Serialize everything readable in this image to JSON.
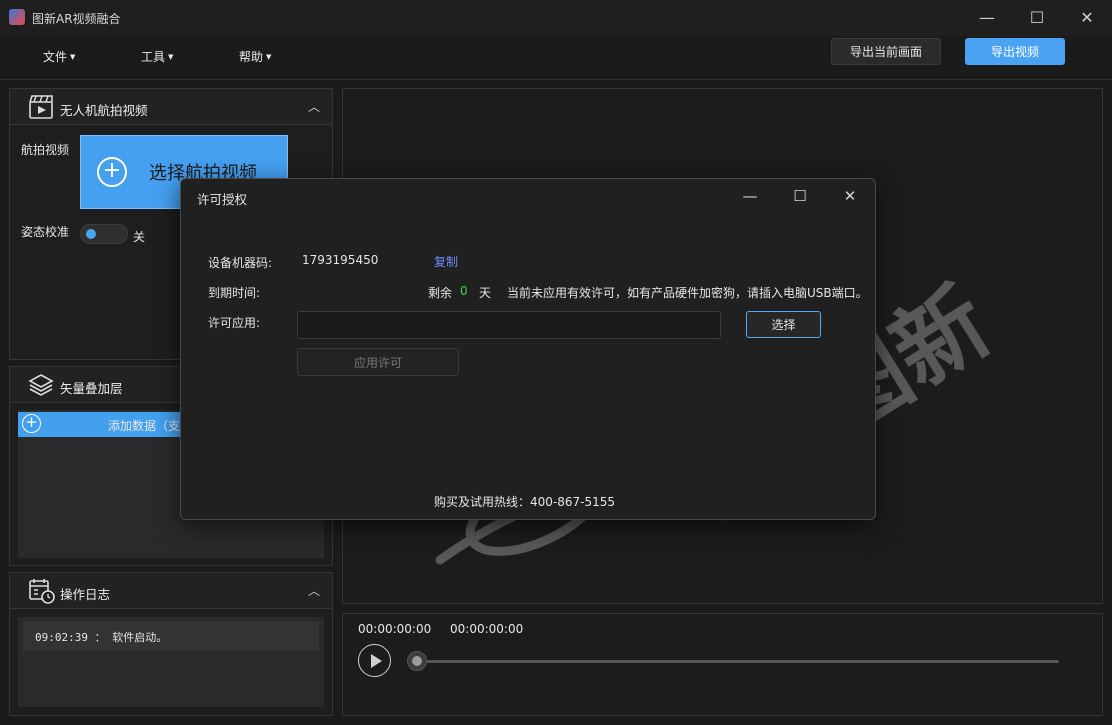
{
  "app": {
    "title": "图新AR视频融合",
    "window_controls": {
      "minimize": "—",
      "maximize": "☐",
      "close": "✕"
    }
  },
  "menu": {
    "items": [
      {
        "label": "文件"
      },
      {
        "label": "工具"
      },
      {
        "label": "帮助"
      }
    ],
    "export_frame_label": "导出当前画面",
    "export_video_label": "导出视频"
  },
  "panels": {
    "aerial": {
      "title": "无人机航拍视频",
      "video_label": "航拍视频",
      "select_button": "选择航拍视频",
      "attitude_label": "姿态校准",
      "attitude_state": "关",
      "icon": "clapperboard-icon"
    },
    "vector": {
      "title": "矢量叠加层",
      "add_data": "添加数据（支",
      "icon": "layers-icon"
    },
    "log": {
      "title": "操作日志",
      "entries": [
        {
          "text": "09:02:39 ： 软件启动。"
        }
      ],
      "icon": "calendar-clock-icon"
    }
  },
  "player": {
    "current_time": "00:00:00:00",
    "total_time": "00:00:00:00",
    "progress": 0
  },
  "dialog": {
    "title": "许可授权",
    "device_label": "设备机器码:",
    "device_code": "1793195450",
    "copy_label": "复制",
    "expiry_label": "到期时间:",
    "remaining_prefix": "剩余",
    "remaining_days": "0",
    "remaining_suffix": "天",
    "notice": "当前未应用有效许可，如有产品硬件加密狗，请插入电脑USB端口。",
    "license_label": "许可应用:",
    "license_value": "",
    "select_button": "选择",
    "apply_button": "应用许可",
    "hotline": "购买及试用热线：400-867-5155"
  },
  "watermark": {
    "text": "中科图新"
  },
  "colors": {
    "accent": "#45a0f0",
    "background": "#1b1b1b",
    "remaining_days": "#3fd24a",
    "copy_link": "#6d8cff"
  }
}
